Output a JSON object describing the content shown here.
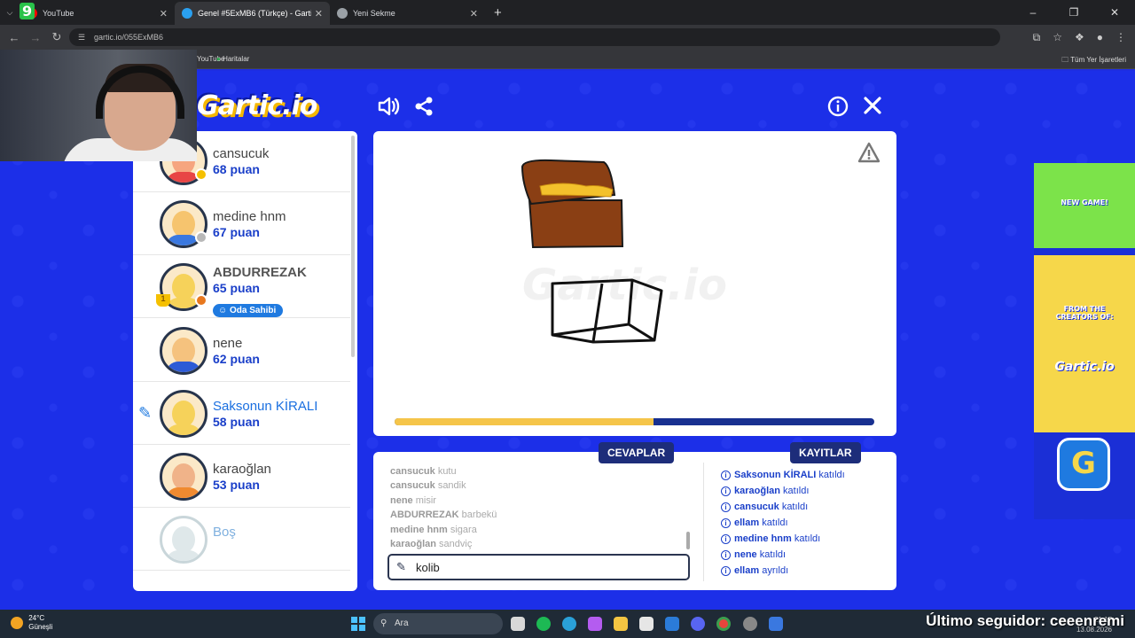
{
  "browser": {
    "tabs": [
      {
        "title": "YouTube",
        "favicon_color": "#ff0000"
      },
      {
        "title": "Genel #5ExMB6 (Türkçe) - Gartic",
        "favicon_color": "#2aa0f0"
      },
      {
        "title": "Yeni Sekme",
        "favicon_color": "#9aa0a6"
      }
    ],
    "url": "gartic.io/055ExMB6",
    "bookmarks": [
      {
        "label": "YouTube"
      },
      {
        "label": "Haritalar"
      }
    ],
    "all_bookmarks": "Tüm Yer İşaretleri"
  },
  "overlay": {
    "logo_text": "9"
  },
  "game": {
    "logo": "Gartic.io",
    "players": [
      {
        "name": "cansucuk",
        "score": "68 puan",
        "badge_color": "#f5c000",
        "skin": "#f6a57f",
        "shirt": "#e84545"
      },
      {
        "name": "medine hnm",
        "score": "67 puan",
        "badge_color": "#b8b8b8",
        "skin": "#f6c46e",
        "shirt": "#3a78e0"
      },
      {
        "name": "ABDURREZAK",
        "score": "65 puan",
        "badge_color": "#e8781e",
        "skin": "#f6d25a",
        "shirt": "#f6d25a",
        "owner_label": "Oda Sahibi",
        "rank": "1"
      },
      {
        "name": "nene",
        "score": "62 puan",
        "badge_color": "",
        "skin": "#f5c27e",
        "shirt": "#2d5bd6"
      },
      {
        "name": "Saksonun KİRALI",
        "score": "58 puan",
        "badge_color": "",
        "skin": "#f6d25a",
        "shirt": "#f6d25a",
        "drawing": true
      },
      {
        "name": "karaoğlan",
        "score": "53 puan",
        "badge_color": "",
        "skin": "#f0b389",
        "shirt": "#f08a30"
      },
      {
        "name": "Boş",
        "score": "",
        "badge_color": "",
        "skin": "#dfe8ea",
        "shirt": "#dfe8ea"
      }
    ],
    "progress": 0.54,
    "tabs": {
      "answers": "CEVAPLAR",
      "logs": "KAYITLAR"
    },
    "answers": [
      {
        "user": "cansucuk",
        "text": "kutu"
      },
      {
        "user": "cansucuk",
        "text": "sandik"
      },
      {
        "user": "nene",
        "text": "misir"
      },
      {
        "user": "ABDURREZAK",
        "text": "barbekü"
      },
      {
        "user": "medine hnm",
        "text": "sigara"
      },
      {
        "user": "karaoğlan",
        "text": "sandviç"
      }
    ],
    "logs": [
      {
        "user": "Saksonun KİRALI",
        "action": "katıldı"
      },
      {
        "user": "karaoğlan",
        "action": "katıldı"
      },
      {
        "user": "cansucuk",
        "action": "katıldı"
      },
      {
        "user": "ellam",
        "action": "katıldı"
      },
      {
        "user": "medine hnm",
        "action": "katıldı"
      },
      {
        "user": "nene",
        "action": "katıldı"
      },
      {
        "user": "ellam",
        "action": "ayrıldı"
      }
    ],
    "guess_value": "kolib"
  },
  "ad": {
    "new_game": "NEW GAME!",
    "from_creators": "FROM THE CREATORS OF:",
    "brand": "Gartic.io",
    "app_letter": "G"
  },
  "taskbar": {
    "temp": "24°C",
    "weather": "Güneşli",
    "search": "Ara",
    "follower": "Último seguidor: ceeenremi",
    "time": "21:17",
    "date": "13.08.2026"
  }
}
